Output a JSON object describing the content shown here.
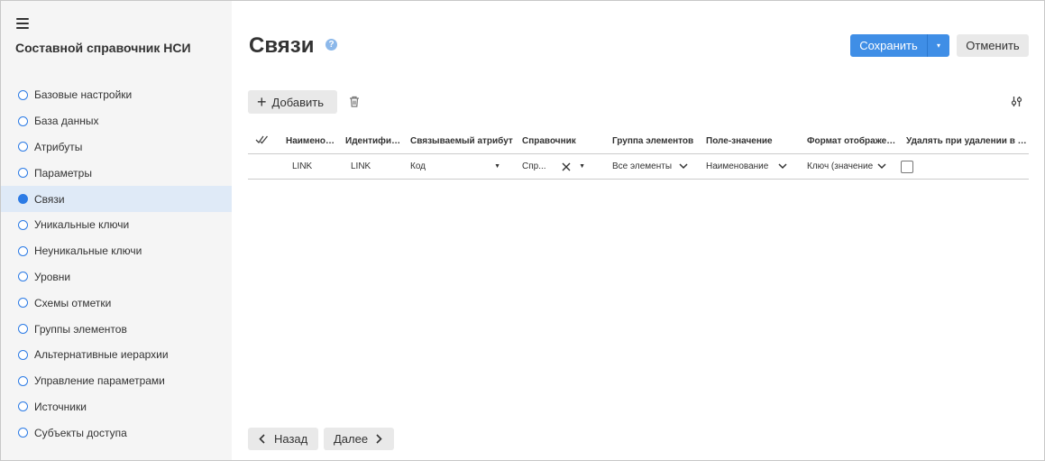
{
  "sidebar": {
    "title": "Составной справочник НСИ",
    "items": [
      {
        "label": "Базовые настройки",
        "active": false
      },
      {
        "label": "База данных",
        "active": false
      },
      {
        "label": "Атрибуты",
        "active": false
      },
      {
        "label": "Параметры",
        "active": false
      },
      {
        "label": "Связи",
        "active": true
      },
      {
        "label": "Уникальные ключи",
        "active": false
      },
      {
        "label": "Неуникальные ключи",
        "active": false
      },
      {
        "label": "Уровни",
        "active": false
      },
      {
        "label": "Схемы отметки",
        "active": false
      },
      {
        "label": "Группы элементов",
        "active": false
      },
      {
        "label": "Альтернативные иерархии",
        "active": false
      },
      {
        "label": "Управление параметрами",
        "active": false
      },
      {
        "label": "Источники",
        "active": false
      },
      {
        "label": "Субъекты доступа",
        "active": false
      }
    ]
  },
  "header": {
    "title": "Связи",
    "help": "?",
    "save_label": "Сохранить",
    "save_arrow": "▾",
    "cancel_label": "Отменить"
  },
  "toolbar": {
    "add_label": "Добавить"
  },
  "table": {
    "columns": [
      "Наименование",
      "Идентификатор",
      "Связываемый атрибут",
      "Справочник",
      "Группа элементов",
      "Поле-значение",
      "Формат отображения",
      "Удалять при удалении в справочнике"
    ],
    "rows": [
      {
        "name": "LINK",
        "id": "LINK",
        "attribute": "Код",
        "dictionary": "Спр...",
        "group": "Все элементы",
        "value_field": "Наименование",
        "format": "Ключ (значение",
        "delete_cascade": false
      }
    ]
  },
  "footer": {
    "back_label": "Назад",
    "next_label": "Далее"
  },
  "colors": {
    "accent": "#3f8ee6",
    "active_bg": "#dfeaf7",
    "sidebar_bg": "#f5f5f5"
  }
}
